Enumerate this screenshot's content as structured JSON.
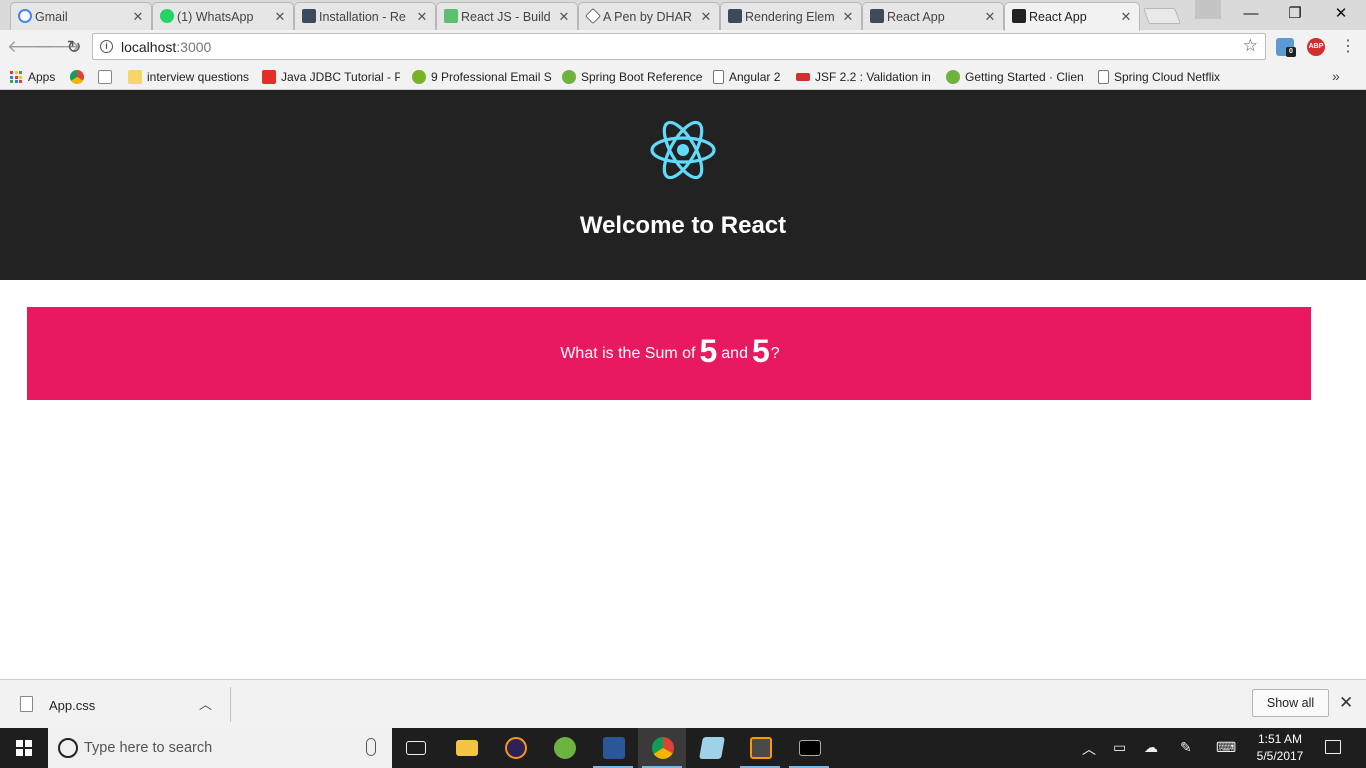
{
  "browser": {
    "tabs": [
      {
        "title": "Gmail",
        "favicon": "gmail-icon",
        "color": "#4285f4",
        "active": false
      },
      {
        "title": "(1) WhatsApp",
        "favicon": "whatsapp-icon",
        "color": "#25d366",
        "active": false
      },
      {
        "title": "Installation - Re",
        "favicon": "react-icon",
        "color": "#3c4a5c",
        "active": false
      },
      {
        "title": "React JS - Build",
        "favicon": "udemy-icon",
        "color": "#5cbf6f",
        "active": false
      },
      {
        "title": "A Pen by DHAR",
        "favicon": "codepen-icon",
        "color": "#444444",
        "active": false
      },
      {
        "title": "Rendering Elem",
        "favicon": "react-icon",
        "color": "#3c4a5c",
        "active": false
      },
      {
        "title": "React App",
        "favicon": "react-icon",
        "color": "#3c4a5c",
        "active": false
      },
      {
        "title": "React App",
        "favicon": "react-icon",
        "color": "#222222",
        "active": true
      }
    ],
    "window_controls": {
      "minimize": "—",
      "restore": "❐",
      "close": "✕"
    },
    "address": {
      "host": "localhost",
      "port": ":3000"
    },
    "bookmarks": [
      {
        "label": "Apps",
        "icon": "apps-grid-icon"
      },
      {
        "label": "",
        "icon": "chrome-icon"
      },
      {
        "label": "",
        "icon": "bookmark-bolt-icon"
      },
      {
        "label": "interview questions",
        "icon": "folder-icon"
      },
      {
        "label": "Java JDBC Tutorial - P",
        "icon": "youtube-icon"
      },
      {
        "label": "9 Professional Email S",
        "icon": "yoast-icon"
      },
      {
        "label": "Spring Boot Reference",
        "icon": "spring-icon"
      },
      {
        "label": "Angular 2",
        "icon": "page-icon"
      },
      {
        "label": "JSF 2.2 : Validation in",
        "icon": "tutorialspoint-icon"
      },
      {
        "label": "Getting Started · Clien",
        "icon": "spring-icon"
      },
      {
        "label": "Spring Cloud Netflix",
        "icon": "page-icon"
      }
    ],
    "bookmarks_overflow": "»",
    "extensions": [
      {
        "name": "extension-badge-icon",
        "badge": "0"
      },
      {
        "name": "adblock-plus-icon",
        "label": "ABP"
      }
    ]
  },
  "page": {
    "header_title": "Welcome to React",
    "question": {
      "prefix": "What is the Sum of",
      "num1": "5",
      "conjunction": "and",
      "num2": "5",
      "suffix": "?"
    },
    "colors": {
      "header_bg": "#222222",
      "question_bg": "#e91961",
      "react_logo": "#61dafb"
    }
  },
  "downloads": {
    "file_name": "App.css",
    "show_all": "Show all"
  },
  "taskbar": {
    "search_placeholder": "Type here to search",
    "pinned": [
      "task-view-icon",
      "file-explorer-icon",
      "eclipse-icon",
      "spring-tool-icon",
      "word-icon",
      "chrome-icon",
      "notepad-icon",
      "sublime-icon",
      "cmd-icon"
    ],
    "time": "1:51 AM",
    "date": "5/5/2017"
  }
}
